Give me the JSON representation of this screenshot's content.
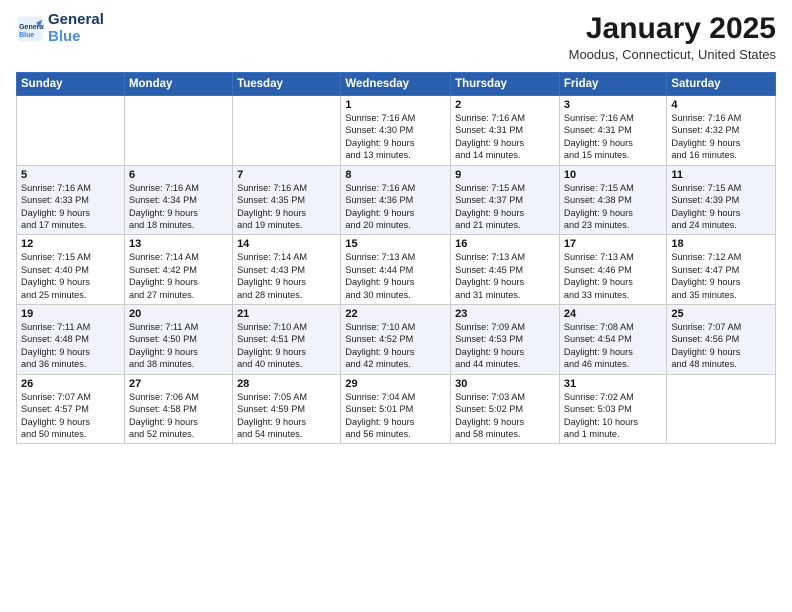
{
  "logo": {
    "line1": "General",
    "line2": "Blue"
  },
  "title": "January 2025",
  "subtitle": "Moodus, Connecticut, United States",
  "weekdays": [
    "Sunday",
    "Monday",
    "Tuesday",
    "Wednesday",
    "Thursday",
    "Friday",
    "Saturday"
  ],
  "weeks": [
    [
      {
        "day": "",
        "info": ""
      },
      {
        "day": "",
        "info": ""
      },
      {
        "day": "",
        "info": ""
      },
      {
        "day": "1",
        "info": "Sunrise: 7:16 AM\nSunset: 4:30 PM\nDaylight: 9 hours\nand 13 minutes."
      },
      {
        "day": "2",
        "info": "Sunrise: 7:16 AM\nSunset: 4:31 PM\nDaylight: 9 hours\nand 14 minutes."
      },
      {
        "day": "3",
        "info": "Sunrise: 7:16 AM\nSunset: 4:31 PM\nDaylight: 9 hours\nand 15 minutes."
      },
      {
        "day": "4",
        "info": "Sunrise: 7:16 AM\nSunset: 4:32 PM\nDaylight: 9 hours\nand 16 minutes."
      }
    ],
    [
      {
        "day": "5",
        "info": "Sunrise: 7:16 AM\nSunset: 4:33 PM\nDaylight: 9 hours\nand 17 minutes."
      },
      {
        "day": "6",
        "info": "Sunrise: 7:16 AM\nSunset: 4:34 PM\nDaylight: 9 hours\nand 18 minutes."
      },
      {
        "day": "7",
        "info": "Sunrise: 7:16 AM\nSunset: 4:35 PM\nDaylight: 9 hours\nand 19 minutes."
      },
      {
        "day": "8",
        "info": "Sunrise: 7:16 AM\nSunset: 4:36 PM\nDaylight: 9 hours\nand 20 minutes."
      },
      {
        "day": "9",
        "info": "Sunrise: 7:15 AM\nSunset: 4:37 PM\nDaylight: 9 hours\nand 21 minutes."
      },
      {
        "day": "10",
        "info": "Sunrise: 7:15 AM\nSunset: 4:38 PM\nDaylight: 9 hours\nand 23 minutes."
      },
      {
        "day": "11",
        "info": "Sunrise: 7:15 AM\nSunset: 4:39 PM\nDaylight: 9 hours\nand 24 minutes."
      }
    ],
    [
      {
        "day": "12",
        "info": "Sunrise: 7:15 AM\nSunset: 4:40 PM\nDaylight: 9 hours\nand 25 minutes."
      },
      {
        "day": "13",
        "info": "Sunrise: 7:14 AM\nSunset: 4:42 PM\nDaylight: 9 hours\nand 27 minutes."
      },
      {
        "day": "14",
        "info": "Sunrise: 7:14 AM\nSunset: 4:43 PM\nDaylight: 9 hours\nand 28 minutes."
      },
      {
        "day": "15",
        "info": "Sunrise: 7:13 AM\nSunset: 4:44 PM\nDaylight: 9 hours\nand 30 minutes."
      },
      {
        "day": "16",
        "info": "Sunrise: 7:13 AM\nSunset: 4:45 PM\nDaylight: 9 hours\nand 31 minutes."
      },
      {
        "day": "17",
        "info": "Sunrise: 7:13 AM\nSunset: 4:46 PM\nDaylight: 9 hours\nand 33 minutes."
      },
      {
        "day": "18",
        "info": "Sunrise: 7:12 AM\nSunset: 4:47 PM\nDaylight: 9 hours\nand 35 minutes."
      }
    ],
    [
      {
        "day": "19",
        "info": "Sunrise: 7:11 AM\nSunset: 4:48 PM\nDaylight: 9 hours\nand 36 minutes."
      },
      {
        "day": "20",
        "info": "Sunrise: 7:11 AM\nSunset: 4:50 PM\nDaylight: 9 hours\nand 38 minutes."
      },
      {
        "day": "21",
        "info": "Sunrise: 7:10 AM\nSunset: 4:51 PM\nDaylight: 9 hours\nand 40 minutes."
      },
      {
        "day": "22",
        "info": "Sunrise: 7:10 AM\nSunset: 4:52 PM\nDaylight: 9 hours\nand 42 minutes."
      },
      {
        "day": "23",
        "info": "Sunrise: 7:09 AM\nSunset: 4:53 PM\nDaylight: 9 hours\nand 44 minutes."
      },
      {
        "day": "24",
        "info": "Sunrise: 7:08 AM\nSunset: 4:54 PM\nDaylight: 9 hours\nand 46 minutes."
      },
      {
        "day": "25",
        "info": "Sunrise: 7:07 AM\nSunset: 4:56 PM\nDaylight: 9 hours\nand 48 minutes."
      }
    ],
    [
      {
        "day": "26",
        "info": "Sunrise: 7:07 AM\nSunset: 4:57 PM\nDaylight: 9 hours\nand 50 minutes."
      },
      {
        "day": "27",
        "info": "Sunrise: 7:06 AM\nSunset: 4:58 PM\nDaylight: 9 hours\nand 52 minutes."
      },
      {
        "day": "28",
        "info": "Sunrise: 7:05 AM\nSunset: 4:59 PM\nDaylight: 9 hours\nand 54 minutes."
      },
      {
        "day": "29",
        "info": "Sunrise: 7:04 AM\nSunset: 5:01 PM\nDaylight: 9 hours\nand 56 minutes."
      },
      {
        "day": "30",
        "info": "Sunrise: 7:03 AM\nSunset: 5:02 PM\nDaylight: 9 hours\nand 58 minutes."
      },
      {
        "day": "31",
        "info": "Sunrise: 7:02 AM\nSunset: 5:03 PM\nDaylight: 10 hours\nand 1 minute."
      },
      {
        "day": "",
        "info": ""
      }
    ]
  ]
}
